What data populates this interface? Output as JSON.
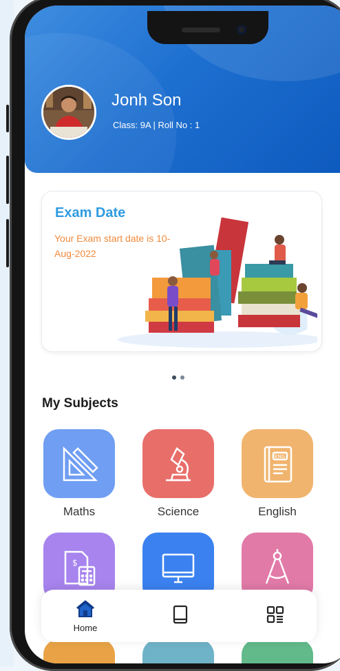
{
  "student": {
    "name": "Jonh Son",
    "meta": "Class: 9A | Roll No : 1"
  },
  "exam_card": {
    "title": "Exam Date",
    "text": "Your Exam start date is 10-Aug-2022"
  },
  "carousel": {
    "total": 2,
    "active": 1
  },
  "subjects": {
    "title": "My Subjects",
    "items": [
      {
        "label": "Maths",
        "color": "#6f9ef2",
        "icon": "geometry-icon"
      },
      {
        "label": "Science",
        "color": "#e86e6a",
        "icon": "microscope-icon"
      },
      {
        "label": "English",
        "color": "#f0b46e",
        "icon": "book-eng-icon"
      },
      {
        "label": "",
        "color": "#a784ee",
        "icon": "accounts-icon"
      },
      {
        "label": "",
        "color": "#3b82f0",
        "icon": "computer-icon"
      },
      {
        "label": "",
        "color": "#e27aa8",
        "icon": "compass-icon"
      }
    ]
  },
  "nav": {
    "home_label": "Home",
    "items": [
      {
        "icon": "home-icon",
        "label": "Home"
      },
      {
        "icon": "book-icon",
        "label": ""
      },
      {
        "icon": "grid-menu-icon",
        "label": ""
      }
    ]
  },
  "colors": {
    "header": "#1d6fd0",
    "exam_title": "#2f9be0",
    "exam_text": "#f08a3c"
  }
}
